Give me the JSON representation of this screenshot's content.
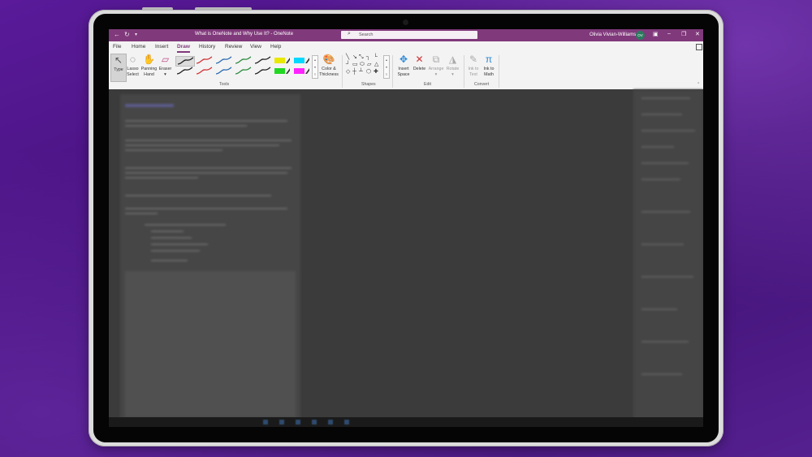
{
  "window": {
    "doc_title": "What is OneNote and Why Use It?  -  OneNote",
    "search_placeholder": "Search",
    "user_name": "Olivia Vivian-Williams",
    "user_initials": "OV"
  },
  "tabs": [
    "File",
    "Home",
    "Insert",
    "Draw",
    "History",
    "Review",
    "View",
    "Help"
  ],
  "active_tab": "Draw",
  "ribbon": {
    "tools": {
      "type_label": "Type",
      "lasso_line1": "Lasso",
      "lasso_line2": "Select",
      "panning_line1": "Panning",
      "panning_line2": "Hand",
      "eraser_label": "Eraser",
      "color_line1": "Color &",
      "color_line2": "Thickness",
      "group_label": "Tools",
      "pens": [
        {
          "color": "#222222",
          "kind": "pen"
        },
        {
          "color": "#d13438",
          "kind": "pen"
        },
        {
          "color": "#2b6cb0",
          "kind": "pen"
        },
        {
          "color": "#2e8b3e",
          "kind": "pen"
        },
        {
          "color": "#222222",
          "kind": "pen"
        },
        {
          "color": "#e8e800",
          "kind": "highlighter"
        },
        {
          "color": "#00d8ff",
          "kind": "highlighter"
        },
        {
          "color": "#222222",
          "kind": "pen"
        },
        {
          "color": "#d13438",
          "kind": "pen"
        },
        {
          "color": "#2b6cb0",
          "kind": "pen"
        },
        {
          "color": "#2e8b3e",
          "kind": "pen"
        },
        {
          "color": "#222222",
          "kind": "pen"
        },
        {
          "color": "#22d822",
          "kind": "highlighter"
        },
        {
          "color": "#ff22ff",
          "kind": "highlighter"
        }
      ]
    },
    "shapes": {
      "group_label": "Shapes"
    },
    "edit": {
      "insert_line1": "Insert",
      "insert_line2": "Space",
      "delete_label": "Delete",
      "arrange_label": "Arrange",
      "rotate_label": "Rotate",
      "group_label": "Edit"
    },
    "convert": {
      "ink_text_line1": "Ink to",
      "ink_text_line2": "Text",
      "ink_math_line1": "Ink to",
      "ink_math_line2": "Math",
      "group_label": "Convert"
    }
  },
  "colors": {
    "titlebar": "#80397b",
    "accent": "#80397b",
    "background_purple": "#4a1580"
  },
  "icons": {
    "back": "back-arrow-icon",
    "redo": "redo-icon",
    "customize": "customize-qat-icon",
    "search": "search-icon"
  }
}
